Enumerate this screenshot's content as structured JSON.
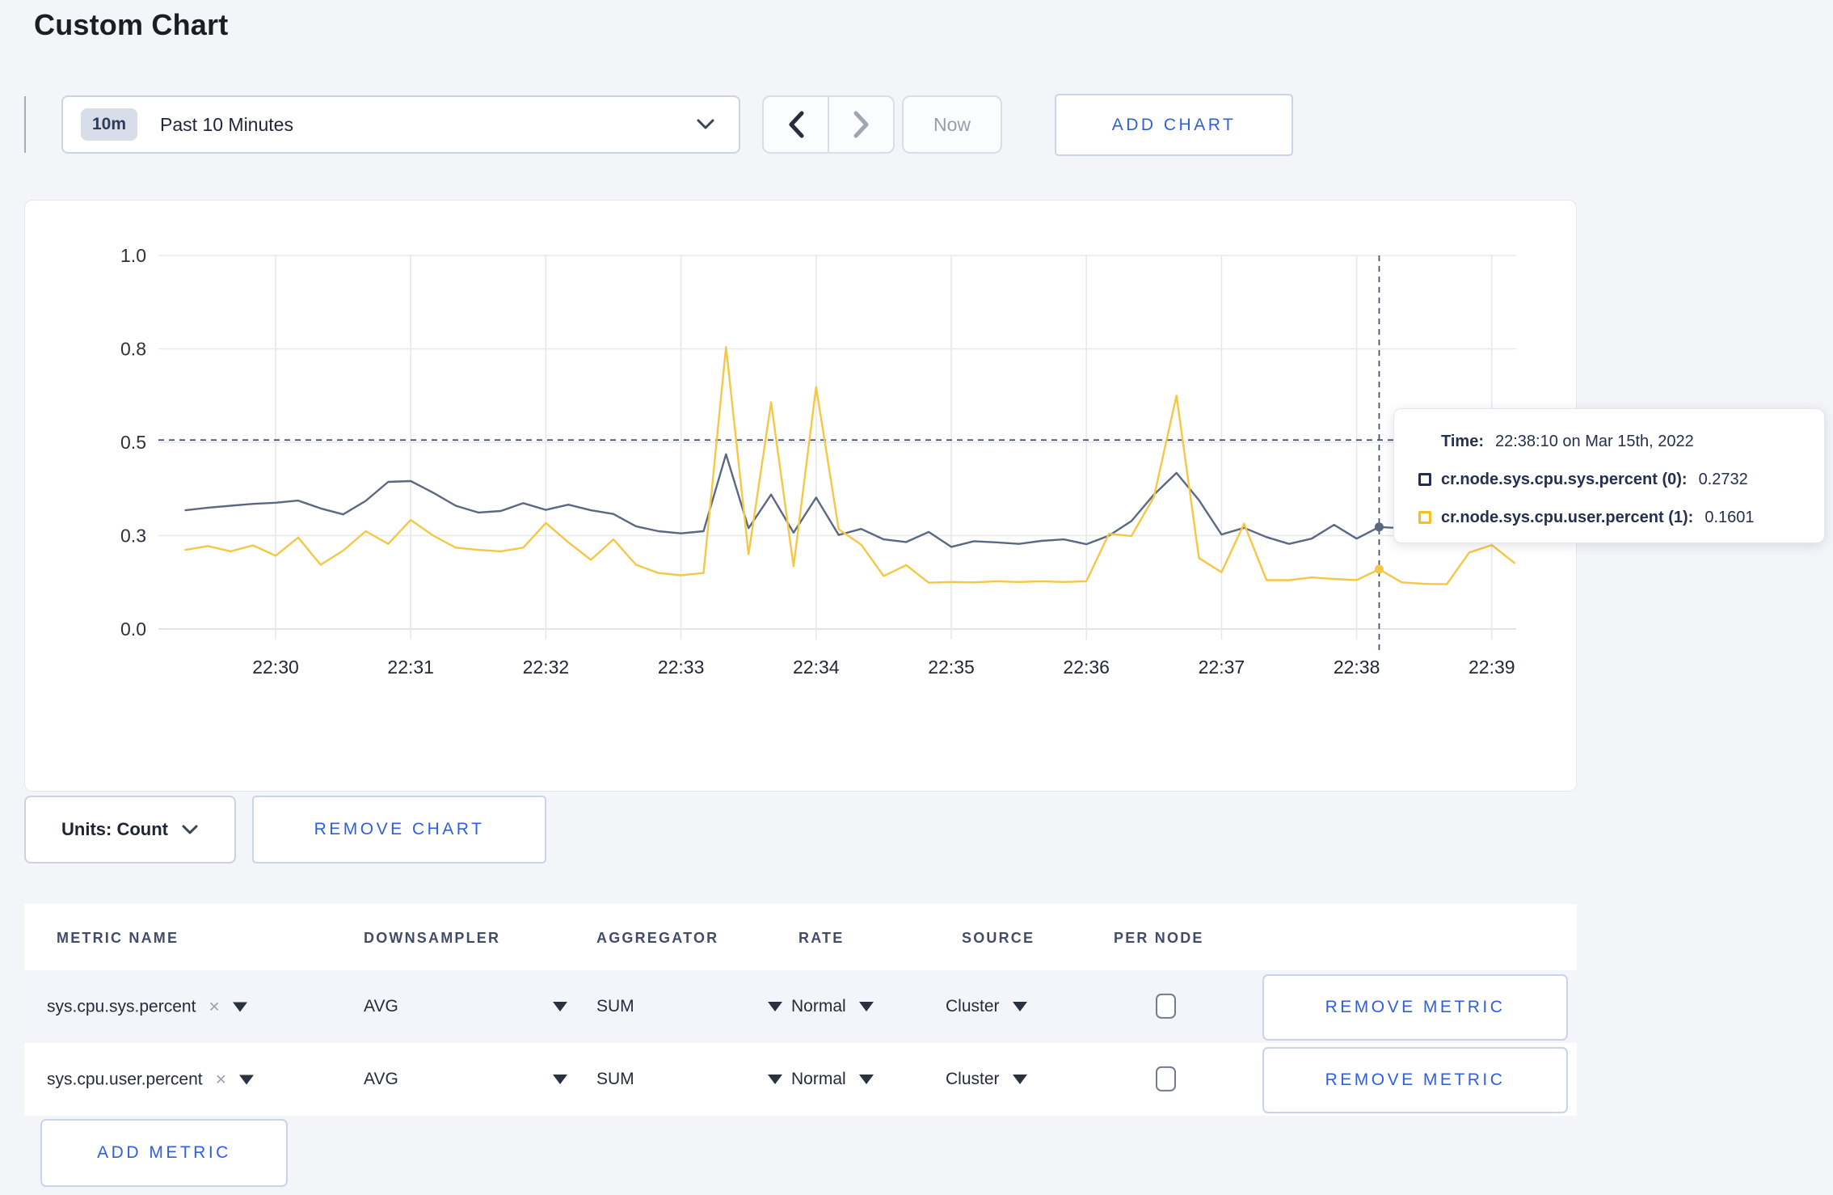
{
  "page_title": "Custom Chart",
  "accent_color": "#2f5fe0",
  "toolbar": {
    "time_range_badge": "10m",
    "time_range_label": "Past 10 Minutes",
    "prev_label": "previous time window",
    "next_label": "next time window",
    "now_label": "Now",
    "add_chart_label": "ADD CHART"
  },
  "chart_controls": {
    "units_label": "Units: Count",
    "remove_chart_label": "REMOVE CHART"
  },
  "tooltip": {
    "time_label": "Time:",
    "time_value": "22:38:10 on Mar 15th, 2022",
    "series": [
      {
        "label": "cr.node.sys.cpu.sys.percent (0):",
        "value": "0.2732",
        "color": "#242e52"
      },
      {
        "label": "cr.node.sys.cpu.user.percent (1):",
        "value": "0.1601",
        "color": "#f5bf1f"
      }
    ]
  },
  "chart_data": {
    "type": "line",
    "title": "",
    "xlabel": "",
    "ylabel": "",
    "grid": true,
    "legend_position": "tooltip",
    "ylim": [
      0,
      1
    ],
    "y_ticks": [
      {
        "label": "0.0",
        "value": 0
      },
      {
        "label": "0.3",
        "value": 0.25
      },
      {
        "label": "0.5",
        "value": 0.5
      },
      {
        "label": "0.8",
        "value": 0.75
      },
      {
        "label": "1.0",
        "value": 1
      }
    ],
    "x_ticks": [
      "22:30",
      "22:31",
      "22:32",
      "22:33",
      "22:34",
      "22:35",
      "22:36",
      "22:37",
      "22:38",
      "22:39"
    ],
    "start_time": "22:29:20",
    "step_seconds": 10,
    "start_offset_seconds": -40,
    "crosshair": {
      "time": "22:38:10",
      "index": 53,
      "h_value": 0.506
    },
    "series": [
      {
        "name": "cr.node.sys.cpu.sys.percent",
        "color": "#5a6882",
        "values": [
          0.318,
          0.325,
          0.33,
          0.335,
          0.338,
          0.344,
          0.323,
          0.307,
          0.343,
          0.394,
          0.396,
          0.365,
          0.33,
          0.312,
          0.316,
          0.337,
          0.319,
          0.333,
          0.318,
          0.308,
          0.275,
          0.262,
          0.256,
          0.262,
          0.468,
          0.27,
          0.36,
          0.258,
          0.352,
          0.252,
          0.268,
          0.24,
          0.233,
          0.26,
          0.22,
          0.235,
          0.232,
          0.228,
          0.236,
          0.24,
          0.227,
          0.25,
          0.289,
          0.36,
          0.418,
          0.345,
          0.253,
          0.271,
          0.246,
          0.228,
          0.242,
          0.279,
          0.242,
          0.2732,
          0.27,
          0.263,
          0.268,
          0.272,
          0.266,
          0.272
        ]
      },
      {
        "name": "cr.node.sys.cpu.user.percent",
        "color": "#f6c744",
        "values": [
          0.212,
          0.222,
          0.208,
          0.224,
          0.196,
          0.245,
          0.172,
          0.21,
          0.262,
          0.228,
          0.292,
          0.25,
          0.218,
          0.212,
          0.208,
          0.218,
          0.284,
          0.232,
          0.185,
          0.24,
          0.172,
          0.15,
          0.144,
          0.15,
          0.755,
          0.2,
          0.607,
          0.168,
          0.648,
          0.267,
          0.226,
          0.142,
          0.171,
          0.124,
          0.126,
          0.125,
          0.128,
          0.126,
          0.128,
          0.126,
          0.128,
          0.255,
          0.249,
          0.354,
          0.625,
          0.19,
          0.152,
          0.282,
          0.131,
          0.131,
          0.138,
          0.134,
          0.131,
          0.1601,
          0.125,
          0.121,
          0.12,
          0.205,
          0.225,
          0.177
        ]
      }
    ]
  },
  "metrics_table": {
    "headers": [
      "METRIC NAME",
      "DOWNSAMPLER",
      "AGGREGATOR",
      "RATE",
      "SOURCE",
      "PER NODE"
    ],
    "clear_icon": "×",
    "rows": [
      {
        "metric_name": "sys.cpu.sys.percent",
        "downsampler": "AVG",
        "aggregator": "SUM",
        "rate": "Normal",
        "source": "Cluster",
        "per_node_checked": false,
        "remove_label": "REMOVE METRIC"
      },
      {
        "metric_name": "sys.cpu.user.percent",
        "downsampler": "AVG",
        "aggregator": "SUM",
        "rate": "Normal",
        "source": "Cluster",
        "per_node_checked": false,
        "remove_label": "REMOVE METRIC"
      }
    ],
    "add_metric_label": "ADD METRIC"
  }
}
